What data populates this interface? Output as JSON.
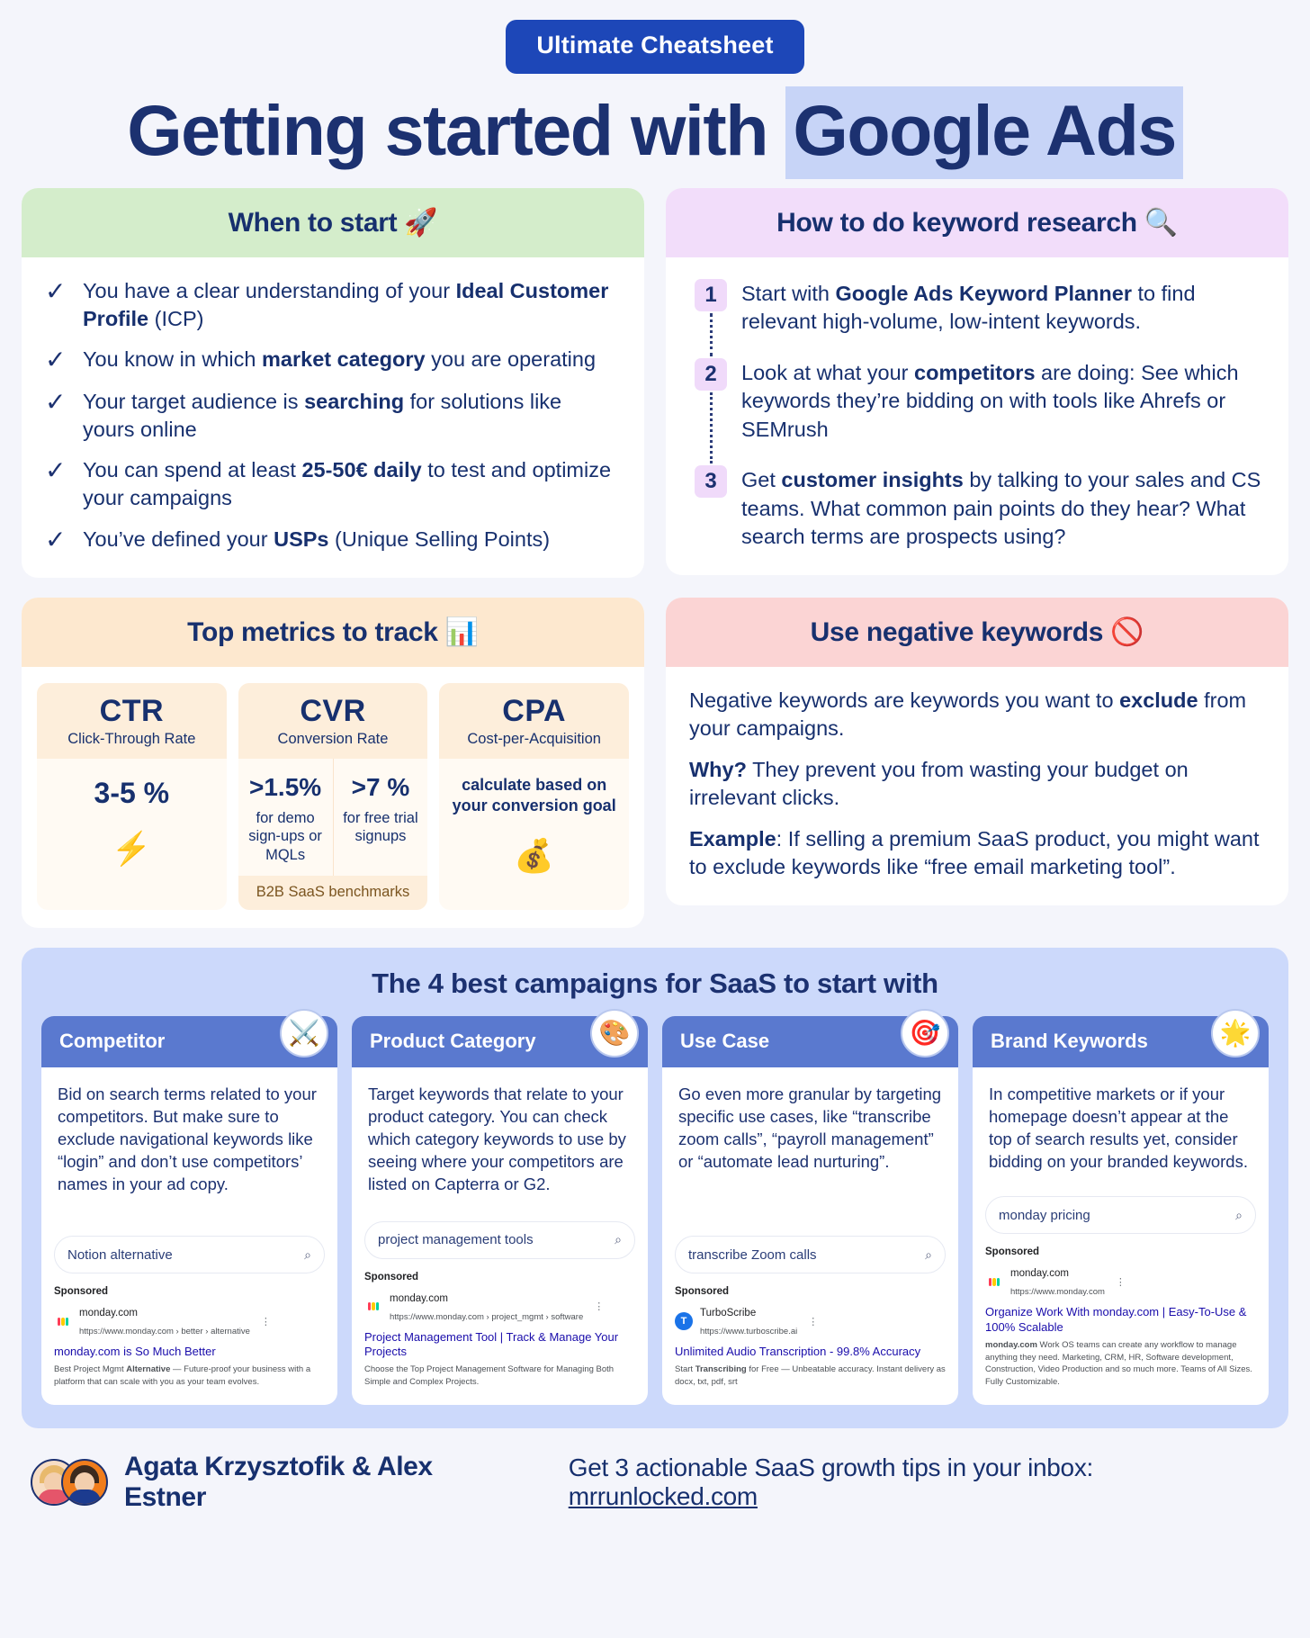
{
  "header": {
    "badge": "Ultimate Cheatsheet",
    "title_part1": "Getting started with ",
    "title_highlight": "Google Ads"
  },
  "when_to_start": {
    "heading": "When to start",
    "emoji": "🚀",
    "items": [
      {
        "pre": "You have a clear understanding of your ",
        "bold": "Ideal Customer Profile",
        "post": " (ICP)"
      },
      {
        "pre": "You know in which ",
        "bold": "market category",
        "post": " you are operating"
      },
      {
        "pre": "Your target audience is ",
        "bold": "searching",
        "post": " for solutions like yours online"
      },
      {
        "pre": "You can spend at least ",
        "bold": "25-50€ daily",
        "post": " to test and optimize your campaigns"
      },
      {
        "pre": "You’ve defined your ",
        "bold": "USPs",
        "post": " (Unique Selling Points)"
      }
    ],
    "check_glyph": "✓"
  },
  "keyword_research": {
    "heading": "How to do keyword research",
    "emoji": "🔍",
    "steps": [
      {
        "num": "1",
        "pre": "Start with ",
        "bold": "Google Ads Keyword Planner",
        "post": " to find relevant high-volume, low-intent keywords."
      },
      {
        "num": "2",
        "pre": "Look at what your ",
        "bold": "competitors",
        "post": " are doing: See which keywords they’re bidding on with tools like Ahrefs or SEMrush"
      },
      {
        "num": "3",
        "pre": "Get ",
        "bold": "customer insights",
        "post": " by talking to your sales and CS teams. What common pain points do they hear? What search terms are prospects using?"
      }
    ]
  },
  "metrics": {
    "heading": "Top metrics to track",
    "emoji": "📊",
    "cards": [
      {
        "abbr": "CTR",
        "full": "Click-Through Rate",
        "value": "3-5 %",
        "emoji": "⚡"
      },
      {
        "abbr": "CVR",
        "full": "Conversion Rate",
        "left_value": ">1.5%",
        "left_sub": "for demo sign-ups or MQLs",
        "right_value": ">7 %",
        "right_sub": "for free trial signups",
        "note": "B2B SaaS benchmarks"
      },
      {
        "abbr": "CPA",
        "full": "Cost-per-Acquisition",
        "calc": "calculate based on your conversion goal",
        "emoji": "💰"
      }
    ]
  },
  "negative_keywords": {
    "heading": "Use negative keywords",
    "emoji": "🚫",
    "paragraphs": [
      {
        "pre": "Negative keywords are keywords you want to ",
        "bold": "exclude",
        "post": " from your campaigns."
      },
      {
        "pre": "",
        "bold": "Why?",
        "post": " They prevent you from wasting your budget on irrelevant clicks."
      },
      {
        "pre": "",
        "bold": "Example",
        "post": ": If selling a premium SaaS product, you might want to exclude keywords like “free email marketing tool”."
      }
    ]
  },
  "campaigns": {
    "title": "The 4 best campaigns for SaaS to start with",
    "cards": [
      {
        "title": "Competitor",
        "icon": "⚔️",
        "desc": "Bid on search terms related to your competitors. But make sure to exclude navigational keywords like “login” and don’t use competitors’ names in your ad copy.",
        "search_query": "Notion alternative",
        "sponsored_label": "Sponsored",
        "domain": "monday.com",
        "url": "https://www.monday.com › better › alternative",
        "headline": "monday.com is So Much Better",
        "desc_pre": "Best Project Mgmt ",
        "desc_bold": "Alternative",
        "desc_post": " — Future-proof your business with a platform that can scale with you as your team evolves.",
        "favicon": "monday"
      },
      {
        "title": "Product Category",
        "icon": "🎨",
        "desc": "Target keywords that relate to your product category. You can check which category keywords to use by seeing where your competitors are listed on Capterra or G2.",
        "search_query": "project management tools",
        "sponsored_label": "Sponsored",
        "domain": "monday.com",
        "url": "https://www.monday.com › project_mgmt › software",
        "headline": "Project Management Tool | Track & Manage Your Projects",
        "desc_pre": "Choose the Top Project Management Software for Managing Both Simple and Complex Projects.",
        "desc_bold": "",
        "desc_post": "",
        "favicon": "monday"
      },
      {
        "title": "Use Case",
        "icon": "🎯",
        "desc": "Go even more granular by targeting specific use cases, like “transcribe zoom calls”, “payroll management” or “automate lead nurturing”.",
        "search_query": "transcribe Zoom calls",
        "sponsored_label": "Sponsored",
        "domain": "TurboScribe",
        "url": "https://www.turboscribe.ai",
        "headline": "Unlimited Audio Transcription - 99.8% Accuracy",
        "desc_pre": "Start ",
        "desc_bold": "Transcribing",
        "desc_post": " for Free — Unbeatable accuracy. Instant delivery as docx, txt, pdf, srt",
        "favicon": "turbo"
      },
      {
        "title": "Brand Keywords",
        "icon": "🌟",
        "desc": "In competitive markets or if your homepage doesn’t appear at the top of search results yet, consider bidding on your branded keywords.",
        "search_query": "monday pricing",
        "sponsored_label": "Sponsored",
        "domain": "monday.com",
        "url": "https://www.monday.com",
        "headline": "Organize Work With monday.com | Easy-To-Use & 100% Scalable",
        "desc_pre": "",
        "desc_bold": "monday.com",
        "desc_post": " Work OS teams can create any workflow to manage anything they need. Marketing, CRM, HR, Software development, Construction, Video Production and so much more. Teams of All Sizes. Fully Customizable.",
        "favicon": "monday"
      }
    ],
    "search_icon": "⌕"
  },
  "footer": {
    "names": "Agata Krzysztofik & Alex Estner",
    "cta_pre": "Get 3 actionable SaaS growth tips in your inbox: ",
    "cta_link": "mrrunlocked.com"
  },
  "colors": {
    "navy": "#1c3170",
    "badge_blue": "#1d47b8",
    "green": "#d4edcb",
    "purple": "#f2ddfa",
    "orange": "#fde8cf",
    "red": "#fbd4d4",
    "campaign_bg": "#ccd9fb",
    "campaign_head": "#5a79cf",
    "serp_link": "#1a0dab"
  }
}
